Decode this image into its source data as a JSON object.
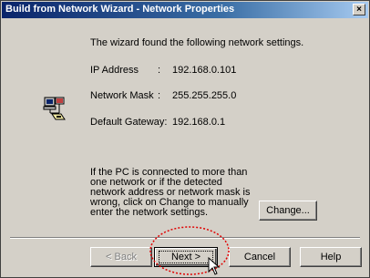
{
  "window": {
    "title": "Build from Network Wizard - Network Properties",
    "close_label": "×"
  },
  "intro": "The wizard found the following network settings.",
  "fields": {
    "ip": {
      "label": "IP Address",
      "sep": ":",
      "value": "192.168.0.101"
    },
    "mask": {
      "label": "Network Mask",
      "sep": ":",
      "value": "255.255.255.0"
    },
    "gateway": {
      "label": "Default Gateway:",
      "value": "192.168.0.1"
    }
  },
  "note": "If the PC is connected to more than one network or if the detected network address or network mask is wrong, click on Change to manually enter the network settings.",
  "buttons": {
    "change": "Change...",
    "back": "< Back",
    "next": "Next >",
    "cancel": "Cancel",
    "help": "Help"
  },
  "icon": "network-computer-icon",
  "colors": {
    "title_bar": "#0a246a",
    "face": "#d4d0c8",
    "annotation": "#e00000"
  }
}
